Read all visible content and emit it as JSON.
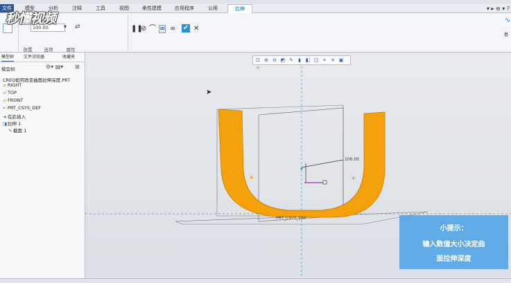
{
  "menu": {
    "tabs": [
      "文件",
      "模型",
      "分析",
      "注释",
      "工具",
      "视图",
      "柔性建模",
      "应用程序",
      "公用",
      "拉伸"
    ],
    "active": "拉伸"
  },
  "ribbon": {
    "depth_value": "100.00",
    "groups": [
      "放置",
      "选项",
      "属性"
    ],
    "right_label": "基"
  },
  "left_panel": {
    "tabs": [
      "模型树",
      "文件浏览器",
      "收藏夹"
    ],
    "header": "模型树",
    "tree": [
      {
        "label": "CREO如何改变曲面拉伸深度.PRT",
        "icon": "part-icon"
      },
      {
        "label": "RIGHT",
        "icon": "datum-plane-icon"
      },
      {
        "label": "TOP",
        "icon": "datum-plane-icon"
      },
      {
        "label": "FRONT",
        "icon": "datum-plane-icon"
      },
      {
        "label": "PRT_CSYS_DEF",
        "icon": "csys-icon"
      },
      {
        "label": "在此插入",
        "icon": "insert-arrow-icon"
      },
      {
        "label": "拉伸 1",
        "icon": "extrude-icon"
      },
      {
        "label": "截面 1",
        "icon": "sketch-icon"
      }
    ]
  },
  "viewport": {
    "dim_value": "100.00",
    "csys_label": "PRT_CSYS_DEF"
  },
  "tip": {
    "line1": "小提示：",
    "line2": "输入数值大小决定曲",
    "line3": "面拉伸深度"
  },
  "watermark": "秒懂视频",
  "colors": {
    "surface": "#f4a10c",
    "accent": "#0e6aa8",
    "tip_bg": "#5aa9e6"
  }
}
